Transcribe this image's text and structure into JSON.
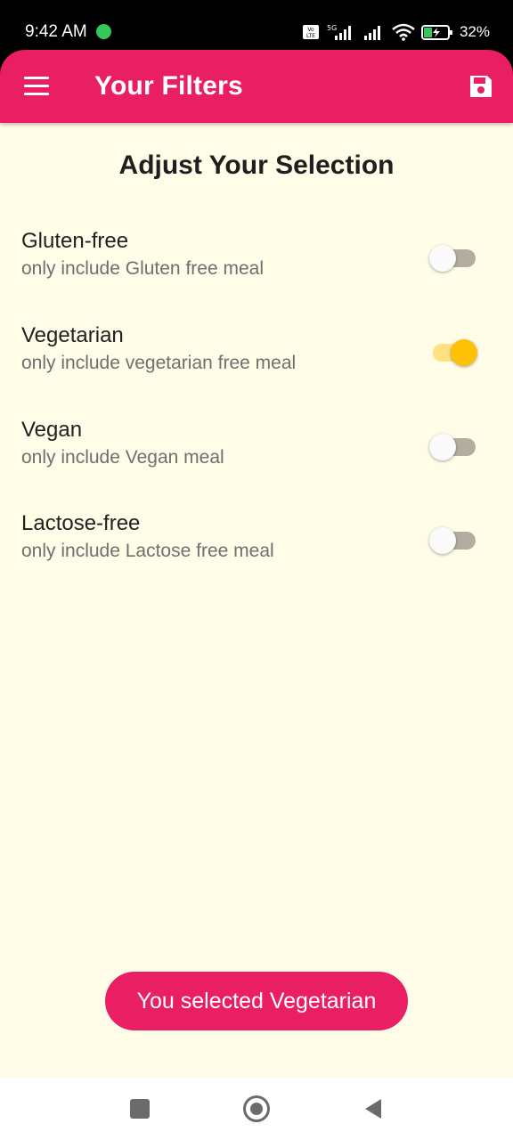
{
  "status_bar": {
    "time": "9:42 AM",
    "battery_percent": "32%",
    "network": "5G",
    "icons": [
      "volte-icon",
      "signal-icon",
      "signal-icon",
      "wifi-icon",
      "battery-charging-icon"
    ]
  },
  "app_bar": {
    "title": "Your Filters",
    "menu_icon": "hamburger-menu-icon",
    "save_icon": "save-icon",
    "color": "#e91e63"
  },
  "main": {
    "heading": "Adjust Your Selection",
    "background": "#fffde7",
    "filters": [
      {
        "title": "Gluten-free",
        "subtitle": "only include Gluten free meal",
        "enabled": false
      },
      {
        "title": "Vegetarian",
        "subtitle": "only include vegetarian  free meal",
        "enabled": true
      },
      {
        "title": "Vegan",
        "subtitle": "only include Vegan meal",
        "enabled": false
      },
      {
        "title": "Lactose-free",
        "subtitle": "only include Lactose free meal",
        "enabled": false
      }
    ]
  },
  "toast": {
    "message": "You selected Vegetarian"
  },
  "nav_bar": {
    "icons": [
      "recent-apps-icon",
      "home-icon",
      "back-icon"
    ]
  },
  "colors": {
    "accent": "#e91e63",
    "switch_on": "#ffc107",
    "switch_on_track": "#ffe082",
    "switch_off_track": "#b2ad9e"
  }
}
